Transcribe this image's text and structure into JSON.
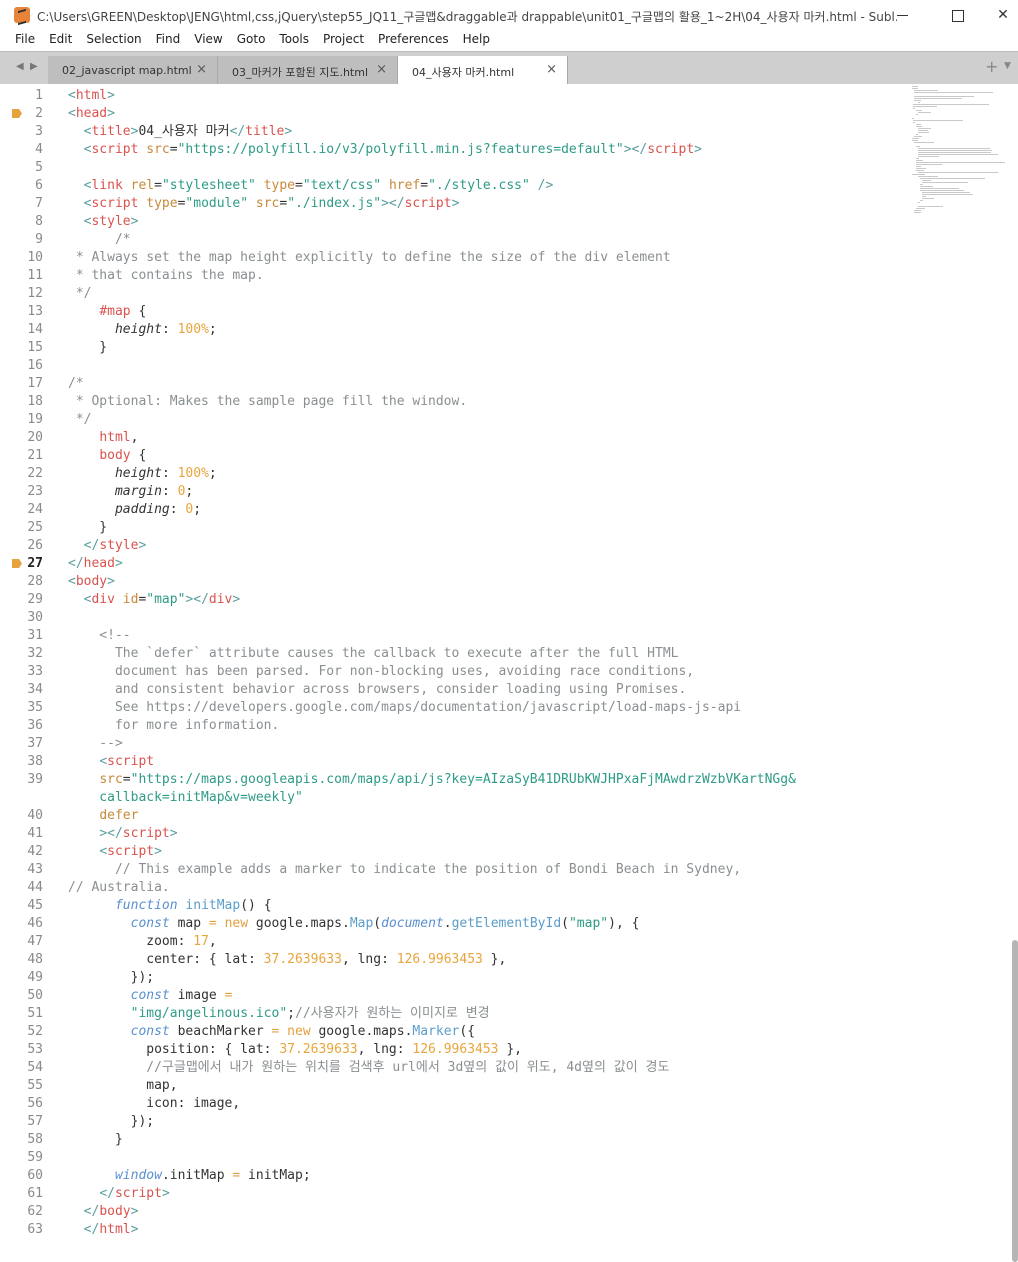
{
  "window": {
    "title": "C:\\Users\\GREEN\\Desktop\\JENG\\html,css,jQuery\\step55_JQ11_구글맵&draggable과 drappable\\unit01_구글맵의 활용_1~2H\\04_사용자 마커.html - Subl...",
    "min": "—",
    "max": "☐",
    "close": "✕"
  },
  "menu": [
    "File",
    "Edit",
    "Selection",
    "Find",
    "View",
    "Goto",
    "Tools",
    "Project",
    "Preferences",
    "Help"
  ],
  "tabs": [
    {
      "label": "02_javascript map.html",
      "active": false
    },
    {
      "label": "03_마커가 포함된 지도.html",
      "active": false
    },
    {
      "label": "04_사용자 마커.html",
      "active": true
    }
  ],
  "tab_controls": {
    "prev": "◀",
    "next": "▶",
    "close": "×",
    "plus": "+",
    "more": "▼"
  },
  "editor": {
    "current_line": 27,
    "bookmarked_lines": [
      2,
      27
    ],
    "line_numbers": [
      "1",
      "2",
      "3",
      "4",
      "5",
      "6",
      "7",
      "8",
      "9",
      "10",
      "11",
      "12",
      "13",
      "14",
      "15",
      "16",
      "17",
      "18",
      "19",
      "20",
      "21",
      "22",
      "23",
      "24",
      "25",
      "26",
      "27",
      "28",
      "29",
      "30",
      "31",
      "32",
      "33",
      "34",
      "35",
      "36",
      "37",
      "38",
      "39",
      "",
      "40",
      "41",
      "42",
      "43",
      "44",
      "45",
      "46",
      "47",
      "48",
      "49",
      "50",
      "51",
      "52",
      "53",
      "54",
      "55",
      "56",
      "57",
      "58",
      "59",
      "60",
      "61",
      "62",
      "63"
    ],
    "lines": [
      [
        [
          "t-br",
          "<"
        ],
        [
          "t-tag",
          "html"
        ],
        [
          "t-br",
          ">"
        ]
      ],
      [
        [
          "t-br",
          "<"
        ],
        [
          "t-tag",
          "head"
        ],
        [
          "t-br",
          ">"
        ]
      ],
      [
        [
          "t-def",
          "  "
        ],
        [
          "t-br",
          "<"
        ],
        [
          "t-tag",
          "title"
        ],
        [
          "t-br",
          ">"
        ],
        [
          "t-def",
          "04_사용자 마커"
        ],
        [
          "t-br",
          "</"
        ],
        [
          "t-tag",
          "title"
        ],
        [
          "t-br",
          ">"
        ]
      ],
      [
        [
          "t-def",
          "  "
        ],
        [
          "t-br",
          "<"
        ],
        [
          "t-tag",
          "script"
        ],
        [
          "t-def",
          " "
        ],
        [
          "t-attr",
          "src"
        ],
        [
          "t-def",
          "="
        ],
        [
          "t-str",
          "\"https://polyfill.io/v3/polyfill.min.js?features=default\""
        ],
        [
          "t-br",
          "></"
        ],
        [
          "t-tag",
          "script"
        ],
        [
          "t-br",
          ">"
        ]
      ],
      [],
      [
        [
          "t-def",
          "  "
        ],
        [
          "t-br",
          "<"
        ],
        [
          "t-tag",
          "link"
        ],
        [
          "t-def",
          " "
        ],
        [
          "t-attr",
          "rel"
        ],
        [
          "t-def",
          "="
        ],
        [
          "t-str",
          "\"stylesheet\""
        ],
        [
          "t-def",
          " "
        ],
        [
          "t-attr",
          "type"
        ],
        [
          "t-def",
          "="
        ],
        [
          "t-str",
          "\"text/css\""
        ],
        [
          "t-def",
          " "
        ],
        [
          "t-attr",
          "href"
        ],
        [
          "t-def",
          "="
        ],
        [
          "t-str",
          "\"./style.css\""
        ],
        [
          "t-def",
          " "
        ],
        [
          "t-br",
          "/>"
        ]
      ],
      [
        [
          "t-def",
          "  "
        ],
        [
          "t-br",
          "<"
        ],
        [
          "t-tag",
          "script"
        ],
        [
          "t-def",
          " "
        ],
        [
          "t-attr",
          "type"
        ],
        [
          "t-def",
          "="
        ],
        [
          "t-str",
          "\"module\""
        ],
        [
          "t-def",
          " "
        ],
        [
          "t-attr",
          "src"
        ],
        [
          "t-def",
          "="
        ],
        [
          "t-str",
          "\"./index.js\""
        ],
        [
          "t-br",
          "></"
        ],
        [
          "t-tag",
          "script"
        ],
        [
          "t-br",
          ">"
        ]
      ],
      [
        [
          "t-def",
          "  "
        ],
        [
          "t-br",
          "<"
        ],
        [
          "t-tag",
          "style"
        ],
        [
          "t-br",
          ">"
        ]
      ],
      [
        [
          "t-cm",
          "      /*"
        ]
      ],
      [
        [
          "t-cm",
          " * Always set the map height explicitly to define the size of the div element"
        ]
      ],
      [
        [
          "t-cm",
          " * that contains the map."
        ]
      ],
      [
        [
          "t-cm",
          " */"
        ]
      ],
      [
        [
          "t-def",
          "    "
        ],
        [
          "t-sel",
          "#map"
        ],
        [
          "t-def",
          " {"
        ]
      ],
      [
        [
          "t-def",
          "      "
        ],
        [
          "t-prop",
          "height"
        ],
        [
          "t-def",
          ": "
        ],
        [
          "t-num",
          "100%"
        ],
        [
          "t-def",
          ";"
        ]
      ],
      [
        [
          "t-def",
          "    }"
        ]
      ],
      [],
      [
        [
          "t-cm",
          "/*"
        ]
      ],
      [
        [
          "t-cm",
          " * Optional: Makes the sample page fill the window."
        ]
      ],
      [
        [
          "t-cm",
          " */"
        ]
      ],
      [
        [
          "t-def",
          "    "
        ],
        [
          "t-sel",
          "html"
        ],
        [
          "t-def",
          ","
        ]
      ],
      [
        [
          "t-def",
          "    "
        ],
        [
          "t-sel",
          "body"
        ],
        [
          "t-def",
          " {"
        ]
      ],
      [
        [
          "t-def",
          "      "
        ],
        [
          "t-prop",
          "height"
        ],
        [
          "t-def",
          ": "
        ],
        [
          "t-num",
          "100%"
        ],
        [
          "t-def",
          ";"
        ]
      ],
      [
        [
          "t-def",
          "      "
        ],
        [
          "t-prop",
          "margin"
        ],
        [
          "t-def",
          ": "
        ],
        [
          "t-num",
          "0"
        ],
        [
          "t-def",
          ";"
        ]
      ],
      [
        [
          "t-def",
          "      "
        ],
        [
          "t-prop",
          "padding"
        ],
        [
          "t-def",
          ": "
        ],
        [
          "t-num",
          "0"
        ],
        [
          "t-def",
          ";"
        ]
      ],
      [
        [
          "t-def",
          "    }"
        ]
      ],
      [
        [
          "t-def",
          "  "
        ],
        [
          "t-br",
          "</"
        ],
        [
          "t-tag",
          "style"
        ],
        [
          "t-br",
          ">"
        ]
      ],
      [
        [
          "t-br",
          "</"
        ],
        [
          "t-tag",
          "head"
        ],
        [
          "t-br",
          ">"
        ]
      ],
      [
        [
          "t-br",
          "<"
        ],
        [
          "t-tag",
          "body"
        ],
        [
          "t-br",
          ">"
        ]
      ],
      [
        [
          "t-def",
          "  "
        ],
        [
          "t-br",
          "<"
        ],
        [
          "t-tag",
          "div"
        ],
        [
          "t-def",
          " "
        ],
        [
          "t-attr",
          "id"
        ],
        [
          "t-def",
          "="
        ],
        [
          "t-str",
          "\"map\""
        ],
        [
          "t-br",
          "></"
        ],
        [
          "t-tag",
          "div"
        ],
        [
          "t-br",
          ">"
        ]
      ],
      [],
      [
        [
          "t-cm",
          "    <!--"
        ]
      ],
      [
        [
          "t-cm",
          "      The `defer` attribute causes the callback to execute after the full HTML"
        ]
      ],
      [
        [
          "t-cm",
          "      document has been parsed. For non-blocking uses, avoiding race conditions,"
        ]
      ],
      [
        [
          "t-cm",
          "      and consistent behavior across browsers, consider loading using Promises."
        ]
      ],
      [
        [
          "t-cm",
          "      See https://developers.google.com/maps/documentation/javascript/load-maps-js-api"
        ]
      ],
      [
        [
          "t-cm",
          "      for more information."
        ]
      ],
      [
        [
          "t-cm",
          "    -->"
        ]
      ],
      [
        [
          "t-def",
          "    "
        ],
        [
          "t-br",
          "<"
        ],
        [
          "t-tag",
          "script"
        ]
      ],
      [
        [
          "t-def",
          "    "
        ],
        [
          "t-attr",
          "src"
        ],
        [
          "t-def",
          "="
        ],
        [
          "t-str",
          "\"https://maps.googleapis.com/maps/api/js?key=AIzaSyB41DRUbKWJHPxaFjMAwdrzWzbVKartNGg&"
        ]
      ],
      [
        [
          "t-str",
          "    callback=initMap&v=weekly\""
        ]
      ],
      [
        [
          "t-def",
          "    "
        ],
        [
          "t-attr",
          "defer"
        ]
      ],
      [
        [
          "t-def",
          "    "
        ],
        [
          "t-br",
          "></"
        ],
        [
          "t-tag",
          "script"
        ],
        [
          "t-br",
          ">"
        ]
      ],
      [
        [
          "t-def",
          "    "
        ],
        [
          "t-br",
          "<"
        ],
        [
          "t-tag",
          "script"
        ],
        [
          "t-br",
          ">"
        ]
      ],
      [
        [
          "t-cm",
          "      // This example adds a marker to indicate the position of Bondi Beach in Sydney,"
        ]
      ],
      [
        [
          "t-cm",
          "// Australia."
        ]
      ],
      [
        [
          "t-def",
          "      "
        ],
        [
          "t-kw",
          "function"
        ],
        [
          "t-def",
          " "
        ],
        [
          "t-fn",
          "initMap"
        ],
        [
          "t-def",
          "() {"
        ]
      ],
      [
        [
          "t-def",
          "        "
        ],
        [
          "t-kw",
          "const"
        ],
        [
          "t-def",
          " map "
        ],
        [
          "t-op",
          "="
        ],
        [
          "t-def",
          " "
        ],
        [
          "t-op",
          "new"
        ],
        [
          "t-def",
          " google"
        ],
        [
          "t-def",
          "."
        ],
        [
          "t-def",
          "maps"
        ],
        [
          "t-def",
          "."
        ],
        [
          "t-fn",
          "Map"
        ],
        [
          "t-def",
          "("
        ],
        [
          "t-obj",
          "document"
        ],
        [
          "t-def",
          "."
        ],
        [
          "t-fn",
          "getElementById"
        ],
        [
          "t-def",
          "("
        ],
        [
          "t-str",
          "\"map\""
        ],
        [
          "t-def",
          "), {"
        ]
      ],
      [
        [
          "t-def",
          "          zoom: "
        ],
        [
          "t-num",
          "17"
        ],
        [
          "t-def",
          ","
        ]
      ],
      [
        [
          "t-def",
          "          center: { lat: "
        ],
        [
          "t-num",
          "37.2639633"
        ],
        [
          "t-def",
          ", lng: "
        ],
        [
          "t-num",
          "126.9963453"
        ],
        [
          "t-def",
          " },"
        ]
      ],
      [
        [
          "t-def",
          "        });"
        ]
      ],
      [
        [
          "t-def",
          "        "
        ],
        [
          "t-kw",
          "const"
        ],
        [
          "t-def",
          " image "
        ],
        [
          "t-op",
          "="
        ]
      ],
      [
        [
          "t-def",
          "        "
        ],
        [
          "t-str",
          "\"img/angelinous.ico\""
        ],
        [
          "t-def",
          ";"
        ],
        [
          "t-cm",
          "//사용자가 원하는 이미지로 변경"
        ]
      ],
      [
        [
          "t-def",
          "        "
        ],
        [
          "t-kw",
          "const"
        ],
        [
          "t-def",
          " beachMarker "
        ],
        [
          "t-op",
          "="
        ],
        [
          "t-def",
          " "
        ],
        [
          "t-op",
          "new"
        ],
        [
          "t-def",
          " google"
        ],
        [
          "t-def",
          "."
        ],
        [
          "t-def",
          "maps"
        ],
        [
          "t-def",
          "."
        ],
        [
          "t-fn",
          "Marker"
        ],
        [
          "t-def",
          "({"
        ]
      ],
      [
        [
          "t-def",
          "          position: { lat: "
        ],
        [
          "t-num",
          "37.2639633"
        ],
        [
          "t-def",
          ", lng: "
        ],
        [
          "t-num",
          "126.9963453"
        ],
        [
          "t-def",
          " },"
        ]
      ],
      [
        [
          "t-cm",
          "          //구글맵에서 내가 원하는 위치를 검색후 url에서 3d옆의 값이 위도, 4d옆의 값이 경도"
        ]
      ],
      [
        [
          "t-def",
          "          map,"
        ]
      ],
      [
        [
          "t-def",
          "          icon: image,"
        ]
      ],
      [
        [
          "t-def",
          "        });"
        ]
      ],
      [
        [
          "t-def",
          "      }"
        ]
      ],
      [],
      [
        [
          "t-def",
          "      "
        ],
        [
          "t-obj",
          "window"
        ],
        [
          "t-def",
          "."
        ],
        [
          "t-def",
          "initMap "
        ],
        [
          "t-op",
          "="
        ],
        [
          "t-def",
          " initMap;"
        ]
      ],
      [
        [
          "t-def",
          "    "
        ],
        [
          "t-br",
          "</"
        ],
        [
          "t-tag",
          "script"
        ],
        [
          "t-br",
          ">"
        ]
      ],
      [
        [
          "t-def",
          "  "
        ],
        [
          "t-br",
          "</"
        ],
        [
          "t-tag",
          "body"
        ],
        [
          "t-br",
          ">"
        ]
      ],
      [
        [
          "t-def",
          "  "
        ],
        [
          "t-br",
          "</"
        ],
        [
          "t-tag",
          "html"
        ],
        [
          "t-br",
          ">"
        ]
      ]
    ]
  }
}
